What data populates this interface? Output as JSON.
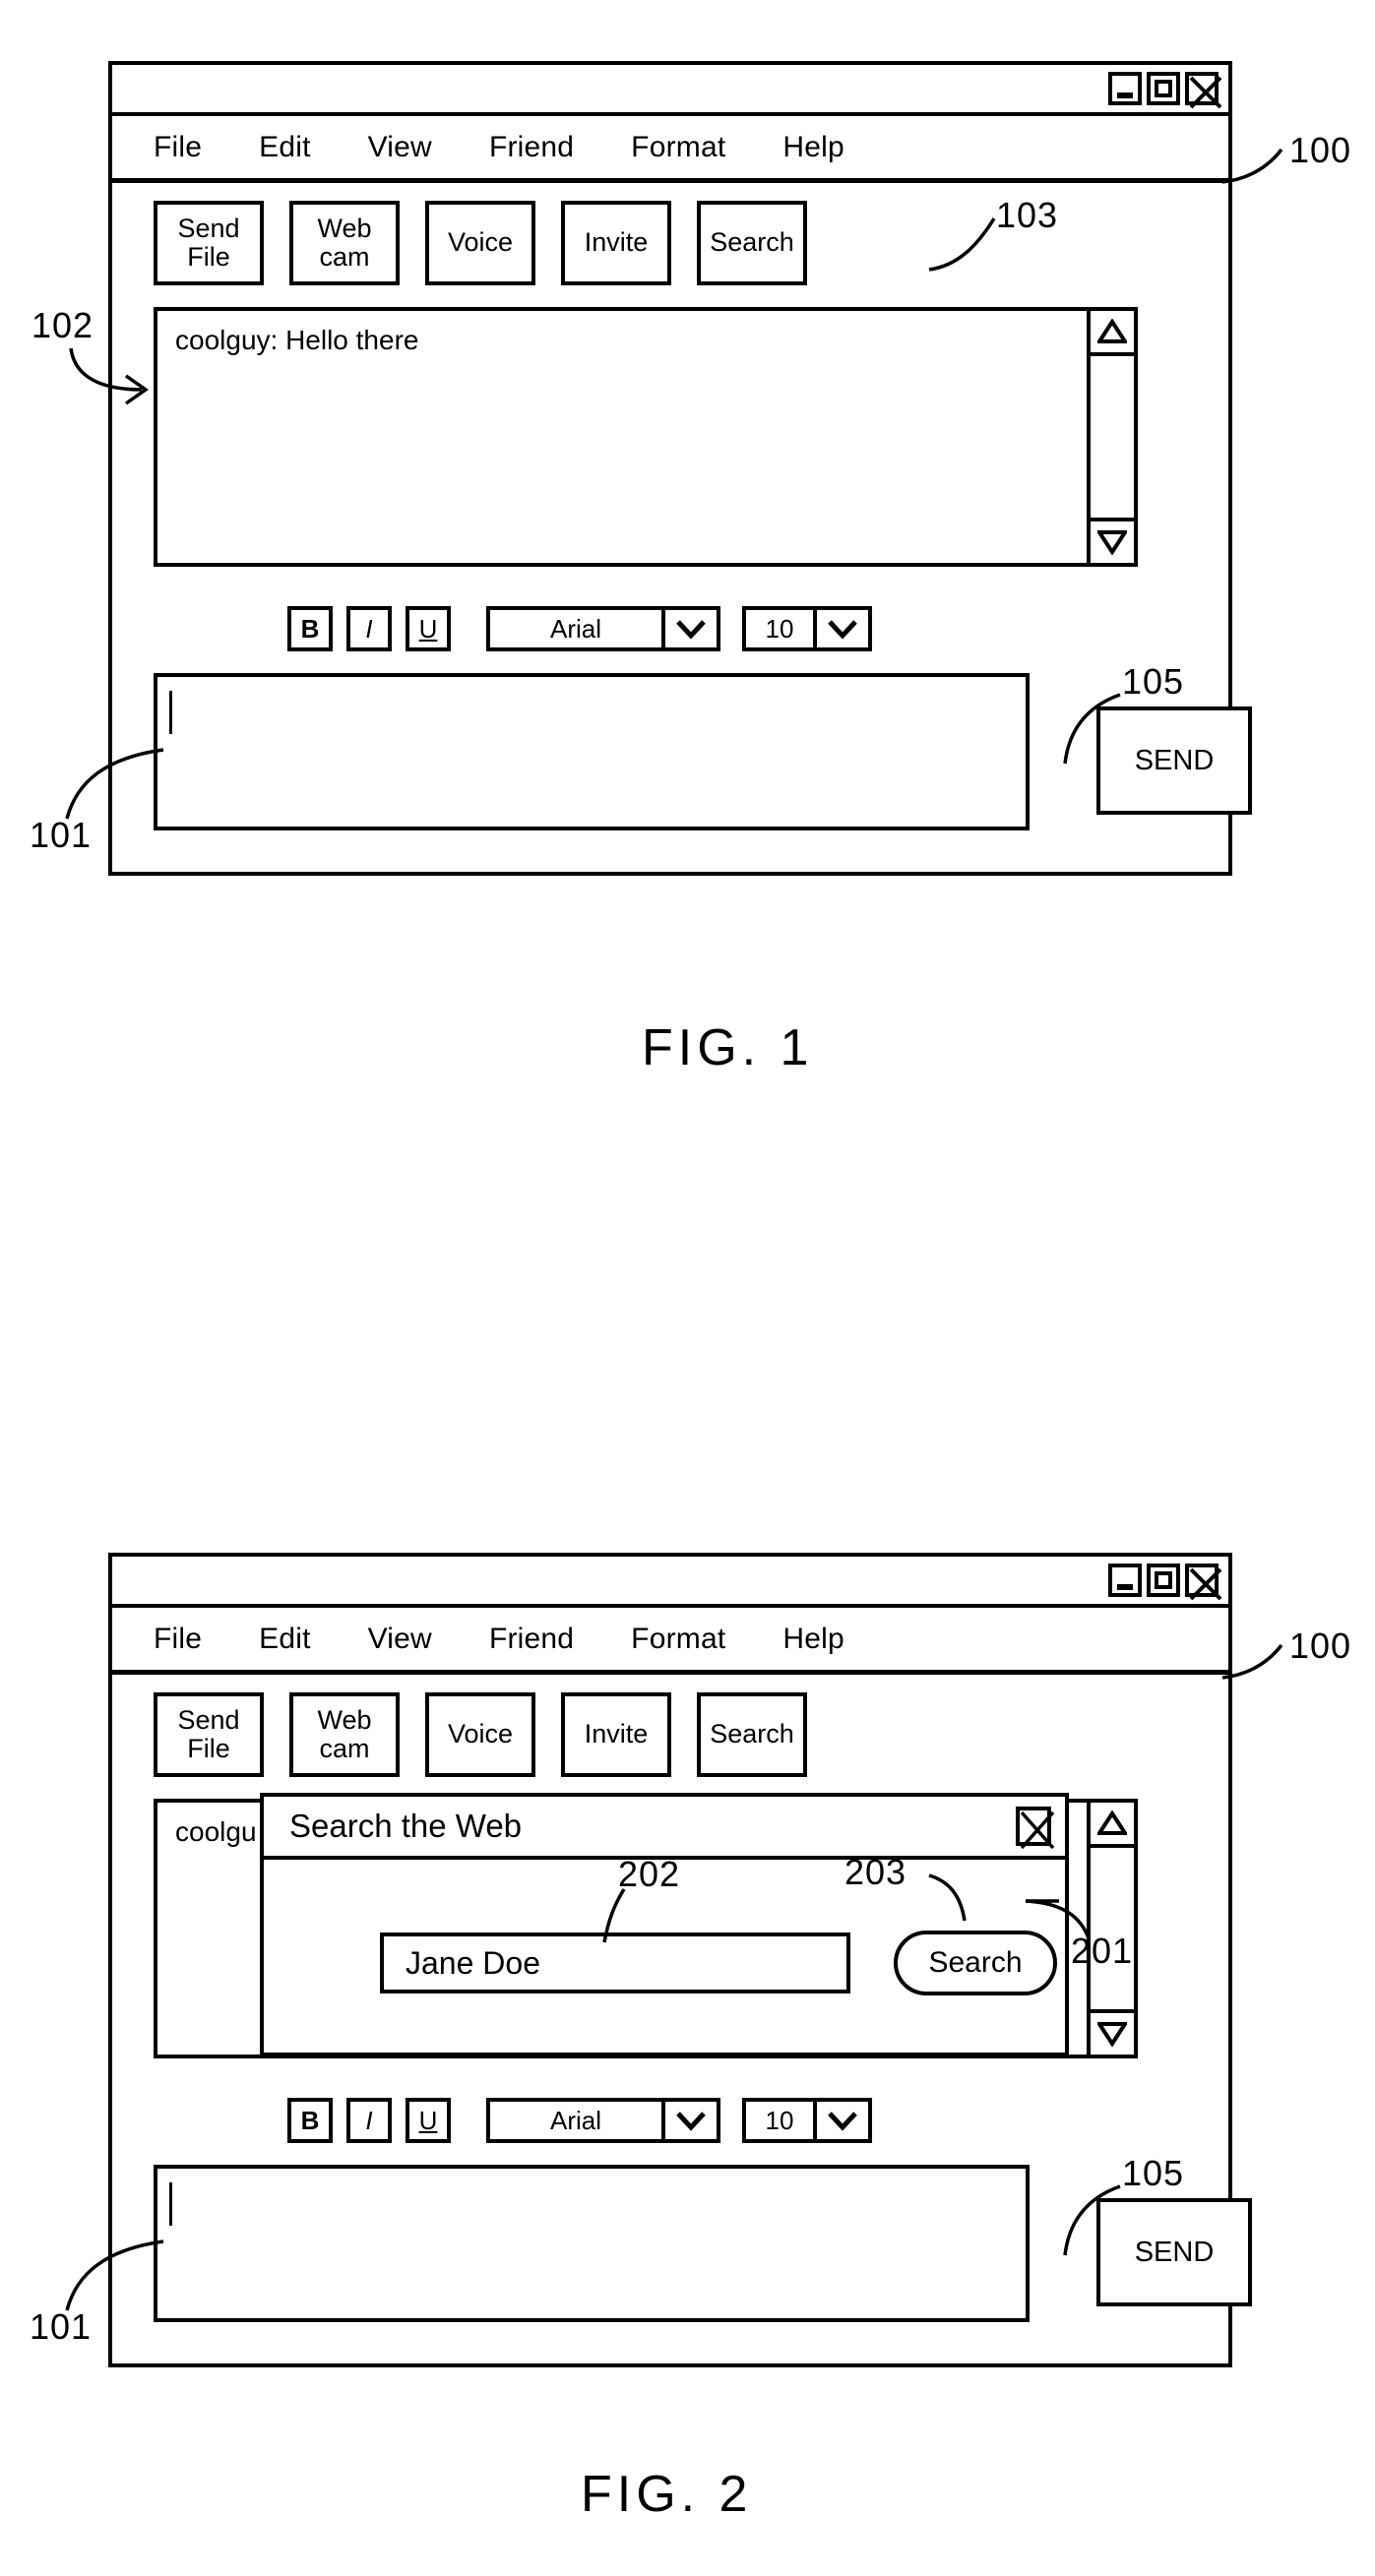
{
  "figures": [
    {
      "label": "FIG. 1",
      "window_ref": "100",
      "titlebar": {
        "controls": [
          {
            "name": "minimize",
            "glyph": "minimize-icon"
          },
          {
            "name": "maximize",
            "glyph": "maximize-icon"
          },
          {
            "name": "close",
            "glyph": "close-icon"
          }
        ]
      },
      "menu": [
        "File",
        "Edit",
        "View",
        "Friend",
        "Format",
        "Help"
      ],
      "toolbar": {
        "ref": "103",
        "buttons": [
          {
            "line1": "Send",
            "line2": "File"
          },
          {
            "line1": "Web",
            "line2": "cam"
          },
          {
            "line1": "Voice",
            "line2": ""
          },
          {
            "line1": "Invite",
            "line2": ""
          },
          {
            "line1": "Search",
            "line2": ""
          }
        ]
      },
      "chat": {
        "ref": "102",
        "message": "coolguy: Hello there",
        "scrollbar": {
          "up": "scroll-up-arrow",
          "down": "scroll-down-arrow"
        }
      },
      "format_bar": {
        "bold": "B",
        "italic": "I",
        "underline": "U",
        "font_family": "Arial",
        "font_size": "10",
        "dropdown_icon": "chevron-down-icon"
      },
      "compose": {
        "ref": "101",
        "value": "",
        "caret": true
      },
      "send": {
        "ref": "105",
        "label": "SEND"
      }
    },
    {
      "label": "FIG. 2",
      "window_ref": "100",
      "titlebar": {
        "controls": [
          {
            "name": "minimize",
            "glyph": "minimize-icon"
          },
          {
            "name": "maximize",
            "glyph": "maximize-icon"
          },
          {
            "name": "close",
            "glyph": "close-icon"
          }
        ]
      },
      "menu": [
        "File",
        "Edit",
        "View",
        "Friend",
        "Format",
        "Help"
      ],
      "toolbar": {
        "ref": "",
        "buttons": [
          {
            "line1": "Send",
            "line2": "File"
          },
          {
            "line1": "Web",
            "line2": "cam"
          },
          {
            "line1": "Voice",
            "line2": ""
          },
          {
            "line1": "Invite",
            "line2": ""
          },
          {
            "line1": "Search",
            "line2": ""
          }
        ]
      },
      "chat": {
        "ref": "",
        "message": "coolgu",
        "scrollbar": {
          "up": "scroll-up-arrow",
          "down": "scroll-down-arrow"
        }
      },
      "dialog": {
        "ref": "201",
        "title": "Search the Web",
        "close_icon": "close-icon",
        "field": {
          "ref": "202",
          "value": "Jane Doe"
        },
        "button": {
          "ref": "203",
          "label": "Search"
        }
      },
      "format_bar": {
        "bold": "B",
        "italic": "I",
        "underline": "U",
        "font_family": "Arial",
        "font_size": "10",
        "dropdown_icon": "chevron-down-icon"
      },
      "compose": {
        "ref": "101",
        "value": "",
        "caret": true
      },
      "send": {
        "ref": "105",
        "label": "SEND"
      }
    }
  ]
}
